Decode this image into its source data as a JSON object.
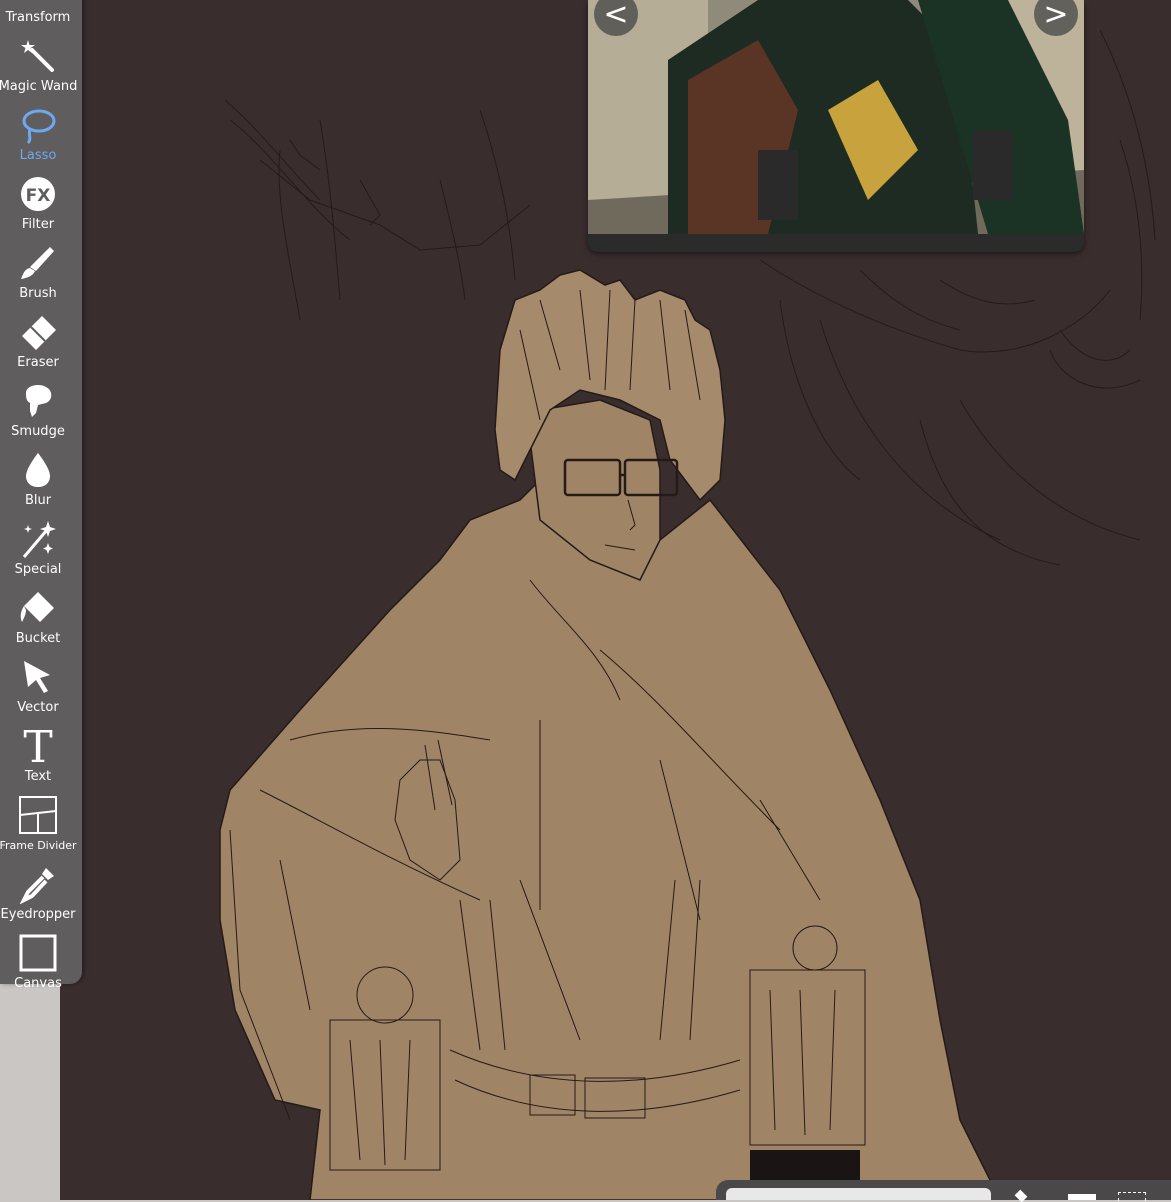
{
  "toolbar": {
    "tools": [
      {
        "id": "transform",
        "label": "Transform",
        "icon": "transform-icon"
      },
      {
        "id": "magic-wand",
        "label": "Magic Wand",
        "icon": "magic-wand-icon"
      },
      {
        "id": "lasso",
        "label": "Lasso",
        "icon": "lasso-icon",
        "active": true
      },
      {
        "id": "filter",
        "label": "Filter",
        "icon": "fx-icon"
      },
      {
        "id": "brush",
        "label": "Brush",
        "icon": "brush-icon"
      },
      {
        "id": "eraser",
        "label": "Eraser",
        "icon": "eraser-icon"
      },
      {
        "id": "smudge",
        "label": "Smudge",
        "icon": "smudge-icon"
      },
      {
        "id": "blur",
        "label": "Blur",
        "icon": "blur-icon"
      },
      {
        "id": "special",
        "label": "Special",
        "icon": "sparkle-icon"
      },
      {
        "id": "bucket",
        "label": "Bucket",
        "icon": "bucket-icon"
      },
      {
        "id": "vector",
        "label": "Vector",
        "icon": "cursor-icon"
      },
      {
        "id": "text",
        "label": "Text",
        "icon": "text-icon"
      },
      {
        "id": "frame-divider",
        "label": "Frame Divider",
        "icon": "frame-divider-icon"
      },
      {
        "id": "eyedropper",
        "label": "Eyedropper",
        "icon": "eyedropper-icon"
      },
      {
        "id": "canvas",
        "label": "Canvas",
        "icon": "canvas-icon"
      }
    ],
    "active_color": "#6ea8f0"
  },
  "reference": {
    "prev_label": "<",
    "next_label": ">"
  },
  "colors": {
    "canvas_bg": "#3a2d2e",
    "skin_fill": "#a08466",
    "toolbar_bg": "#5f5d5d"
  }
}
